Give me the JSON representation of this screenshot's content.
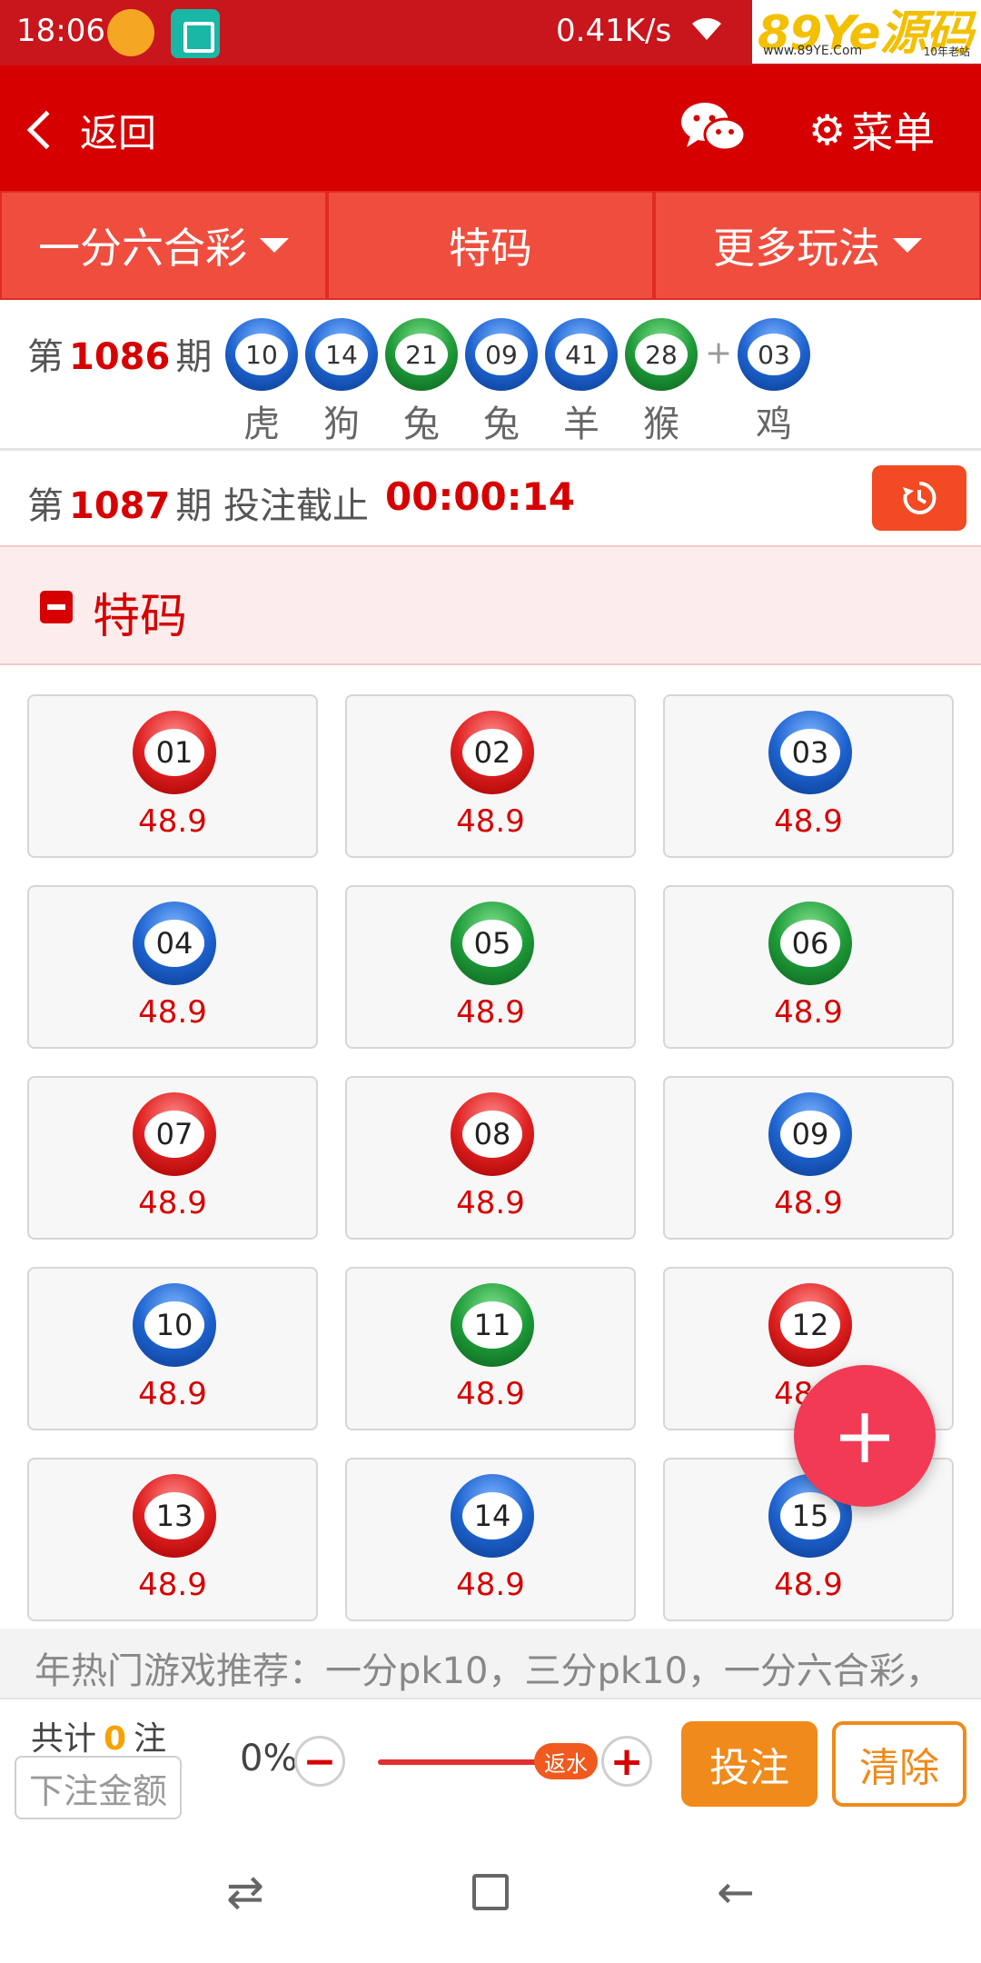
{
  "status_bar": {
    "time": "18:06",
    "speed": "0.41K/s",
    "watermark_main": "89Ye源码",
    "watermark_url": "www.89YE.Com",
    "watermark_tag": "10年老站"
  },
  "header": {
    "back_label": "返回",
    "menu_label": "菜单"
  },
  "tabs": [
    {
      "label": "一分六合彩",
      "has_caret": true
    },
    {
      "label": "特码",
      "has_caret": false
    },
    {
      "label": "更多玩法",
      "has_caret": true
    }
  ],
  "last_draw": {
    "prefix": "第",
    "issue": "1086",
    "suffix": "期",
    "balls": [
      {
        "number": "10",
        "zodiac": "虎",
        "color": "blue"
      },
      {
        "number": "14",
        "zodiac": "狗",
        "color": "blue"
      },
      {
        "number": "21",
        "zodiac": "兔",
        "color": "green"
      },
      {
        "number": "09",
        "zodiac": "兔",
        "color": "blue"
      },
      {
        "number": "41",
        "zodiac": "羊",
        "color": "blue"
      },
      {
        "number": "28",
        "zodiac": "猴",
        "color": "green"
      }
    ],
    "plus": "+",
    "special": {
      "number": "03",
      "zodiac": "鸡",
      "color": "blue"
    }
  },
  "next_draw": {
    "prefix": "第",
    "issue": "1087",
    "suffix": "期 投注截止",
    "countdown": "00:00:14"
  },
  "section": {
    "title": "特码"
  },
  "grid": [
    {
      "number": "01",
      "odds": "48.9",
      "color": "red"
    },
    {
      "number": "02",
      "odds": "48.9",
      "color": "red"
    },
    {
      "number": "03",
      "odds": "48.9",
      "color": "blue"
    },
    {
      "number": "04",
      "odds": "48.9",
      "color": "blue"
    },
    {
      "number": "05",
      "odds": "48.9",
      "color": "green"
    },
    {
      "number": "06",
      "odds": "48.9",
      "color": "green"
    },
    {
      "number": "07",
      "odds": "48.9",
      "color": "red"
    },
    {
      "number": "08",
      "odds": "48.9",
      "color": "red"
    },
    {
      "number": "09",
      "odds": "48.9",
      "color": "blue"
    },
    {
      "number": "10",
      "odds": "48.9",
      "color": "blue"
    },
    {
      "number": "11",
      "odds": "48.9",
      "color": "green"
    },
    {
      "number": "12",
      "odds": "48.9",
      "color": "red"
    },
    {
      "number": "13",
      "odds": "48.9",
      "color": "red"
    },
    {
      "number": "14",
      "odds": "48.9",
      "color": "blue"
    },
    {
      "number": "15",
      "odds": "48.9",
      "color": "blue"
    }
  ],
  "marquee": "年热门游戏推荐：一分pk10，三分pk10，一分六合彩，",
  "bottom": {
    "total_prefix": "共计",
    "total_count": "0",
    "total_suffix": "注",
    "amount_placeholder": "下注金额",
    "rebate_percent": "0%",
    "rebate_label": "返水",
    "bet_label": "投注",
    "clear_label": "清除"
  },
  "colors": {
    "primary": "#d60000",
    "tab": "#ef4e3f",
    "odds": "#d60000",
    "bet": "#f08a1a",
    "fab": "#f23a55"
  }
}
